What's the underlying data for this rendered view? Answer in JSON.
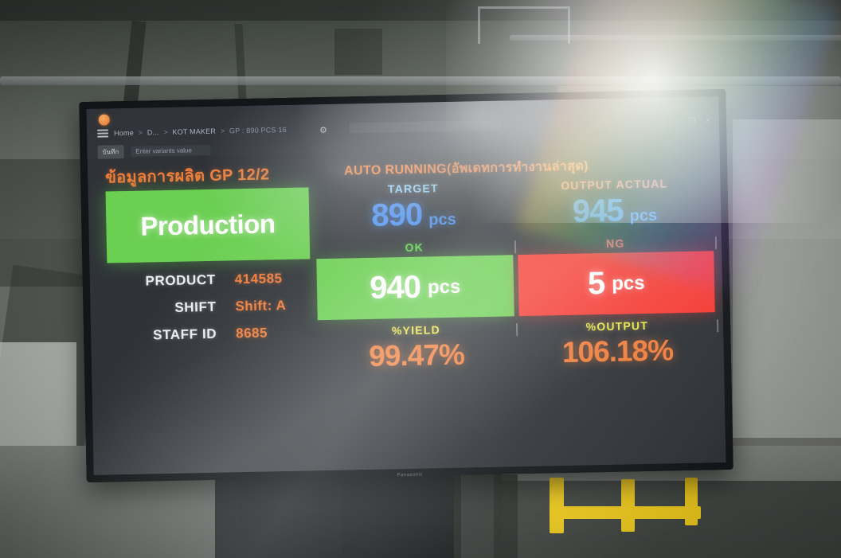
{
  "browser": {
    "logo_icon": "app-logo-icon",
    "menu_icon": "hamburger-menu-icon",
    "breadcrumb": {
      "home": "Home",
      "sep": ">",
      "level2": "D...",
      "level3": "KOT MAKER",
      "level4": "GP : 890 PCS 16"
    },
    "settings_icon": "gear-icon",
    "window_controls": {
      "minimize": "–",
      "maximize": "□",
      "restore": "❐",
      "close": "✕"
    },
    "toolbar": {
      "button_label": "บันทึก",
      "field_placeholder": "Enter variants value",
      "field_value": ""
    }
  },
  "dashboard": {
    "title": "ข้อมูลการผลิต GP 12/2",
    "status_banner": "AUTO RUNNING(อัพเดทการทำงานล่าสุด)",
    "mode_box": "Production",
    "info": [
      {
        "key": "PRODUCT",
        "value": "414585"
      },
      {
        "key": "SHIFT",
        "value": "Shift: A"
      },
      {
        "key": "STAFF ID",
        "value": "8685"
      }
    ],
    "metrics": {
      "target": {
        "label": "TARGET",
        "value": "890",
        "unit": "pcs"
      },
      "output_actual": {
        "label": "OUTPUT ACTUAL",
        "value": "945",
        "unit": "pcs"
      },
      "ok": {
        "label": "OK",
        "value": "940",
        "unit": "pcs"
      },
      "ng": {
        "label": "NG",
        "value": "5",
        "unit": "pcs"
      },
      "yield": {
        "label": "%YIELD",
        "value": "99.47%"
      },
      "output": {
        "label": "%OUTPUT",
        "value": "106.18%"
      }
    },
    "colors": {
      "orange": "#ef7d3c",
      "blue": "#4a8ef0",
      "green": "#6bcf52",
      "red": "#f43b33",
      "yellow": "#e8e24a",
      "screen_bg": "#2f3338"
    }
  },
  "device": {
    "brand": "Panasonic"
  }
}
